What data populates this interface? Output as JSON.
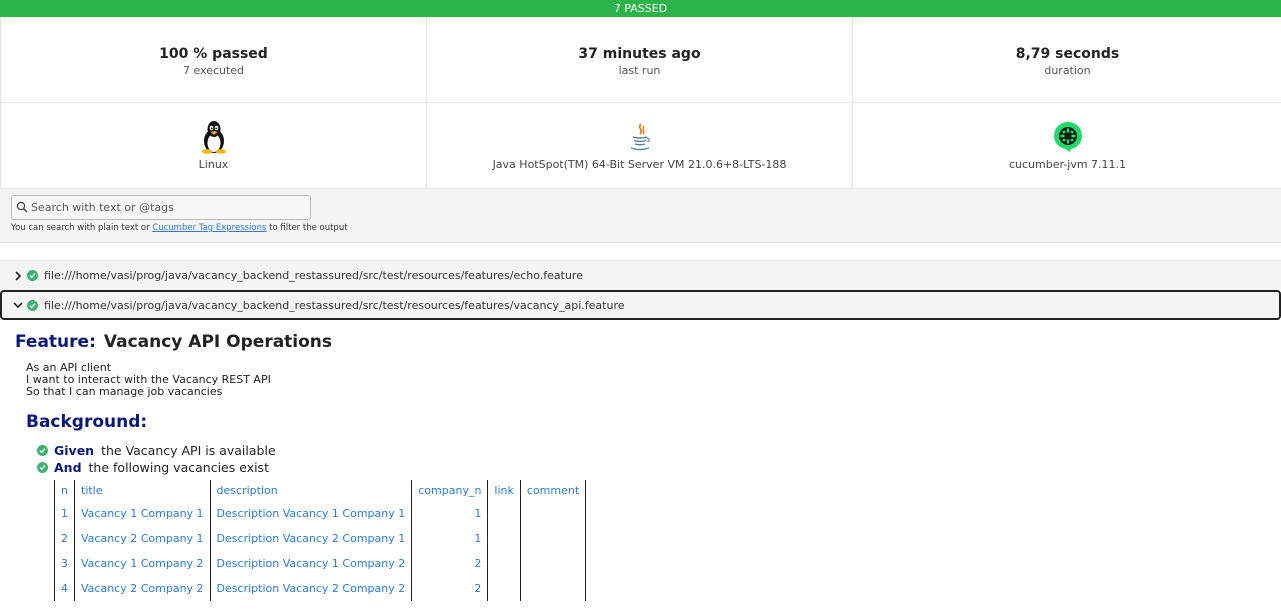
{
  "status_bar": {
    "text": "7 PASSED",
    "color": "#2cb34a"
  },
  "stats": [
    {
      "main": "100 % passed",
      "sub": "7 executed"
    },
    {
      "main": "37 minutes ago",
      "sub": "last run"
    },
    {
      "main": "8,79 seconds",
      "sub": "duration"
    }
  ],
  "environment": [
    {
      "icon": "linux-tux-icon",
      "label": "Linux"
    },
    {
      "icon": "java-icon",
      "label": "Java HotSpot(TM) 64-Bit Server VM 21.0.6+8-LTS-188"
    },
    {
      "icon": "cucumber-icon",
      "label": "cucumber-jvm 7.11.1"
    }
  ],
  "search": {
    "placeholder": "Search with text or @tags",
    "help_prefix": "You can search with plain text or ",
    "help_link": "Cucumber Tag Expressions",
    "help_suffix": " to filter the output"
  },
  "features": [
    {
      "path": "file:///home/vasi/prog/java/vacancy_backend_restassured/src/test/resources/features/echo.feature",
      "expanded": false,
      "status": "passed"
    },
    {
      "path": "file:///home/vasi/prog/java/vacancy_backend_restassured/src/test/resources/features/vacancy_api.feature",
      "expanded": true,
      "status": "passed"
    }
  ],
  "feature_detail": {
    "keyword": "Feature:",
    "name": "Vacancy API Operations",
    "description": [
      "As an API client",
      "I want to interact with the Vacancy REST API",
      "So that I can manage job vacancies"
    ],
    "background_keyword": "Background:",
    "steps": [
      {
        "keyword": "Given",
        "text": "the Vacancy API is available"
      },
      {
        "keyword": "And",
        "text": "the following vacancies exist"
      }
    ],
    "table": {
      "headers": [
        "n",
        "title",
        "description",
        "company_n",
        "link",
        "comment"
      ],
      "rows": [
        [
          "1",
          "Vacancy 1 Company 1",
          "Description Vacancy 1 Company 1",
          "1",
          "",
          ""
        ],
        [
          "2",
          "Vacancy 2 Company 1",
          "Description Vacancy 2 Company 1",
          "1",
          "",
          ""
        ],
        [
          "3",
          "Vacancy 1 Company 2",
          "Description Vacancy 1 Company 2",
          "2",
          "",
          ""
        ],
        [
          "4",
          "Vacancy 2 Company 2",
          "Description Vacancy 2 Company 2",
          "2",
          "",
          ""
        ]
      ]
    }
  }
}
